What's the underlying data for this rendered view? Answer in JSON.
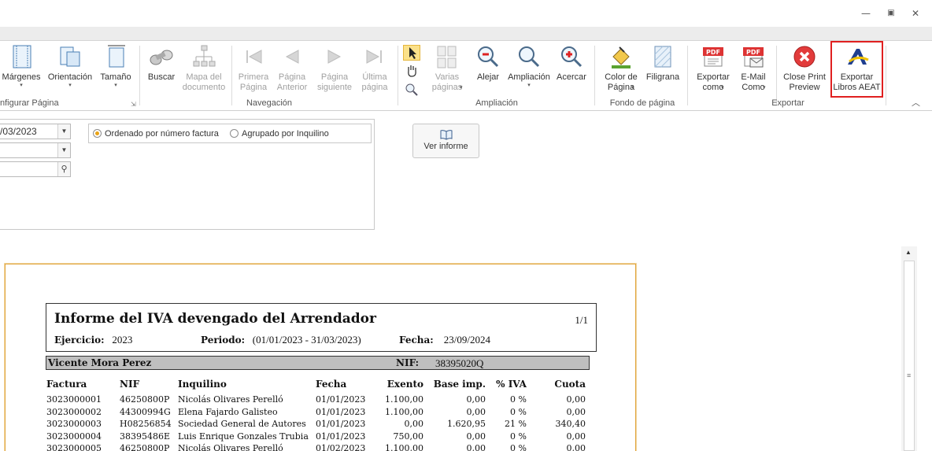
{
  "window": {
    "minimize": "▭",
    "restore": "⧉",
    "close": "✕"
  },
  "ribbon": {
    "groups": [
      {
        "label": "nfigurar Página",
        "buttons": [
          {
            "label": "Márgenes",
            "icon": "margins-icon",
            "arrow": "▾"
          },
          {
            "label": "Orientación",
            "icon": "orientation-icon",
            "arrow": "▾"
          },
          {
            "label": "Tamaño",
            "icon": "page-size-icon",
            "arrow": "▾"
          }
        ]
      },
      {
        "label": "Navegación",
        "buttons": [
          {
            "label": "Buscar",
            "icon": "binoculars-icon"
          },
          {
            "label": "Mapa del\ndocumento",
            "icon": "document-map-icon"
          },
          {
            "label": "Primera\nPágina",
            "icon": "first-page-icon"
          },
          {
            "label": "Página\nAnterior",
            "icon": "previous-page-icon"
          },
          {
            "label": "Página\nsiguiente",
            "icon": "next-page-icon"
          },
          {
            "label": "Última\npágina",
            "icon": "last-page-icon"
          }
        ]
      },
      {
        "label": "Ampliación",
        "buttons": [
          {
            "label": "Varias\npáginas",
            "icon": "multiple-pages-icon",
            "arrow": "▾"
          },
          {
            "label": "Alejar",
            "icon": "zoom-out-icon"
          },
          {
            "label": "Ampliación",
            "icon": "zoom-icon",
            "arrow": "▾"
          },
          {
            "label": "Acercar",
            "icon": "zoom-in-icon"
          }
        ]
      },
      {
        "label": "Fondo de página",
        "buttons": [
          {
            "label": "Color de\nPágina",
            "icon": "page-color-icon",
            "arrow": "▾"
          },
          {
            "label": "Filigrana",
            "icon": "watermark-icon"
          }
        ]
      },
      {
        "label": "Exportar",
        "buttons": [
          {
            "label": "Exportar\ncomo",
            "icon": "pdf-export-icon",
            "arrow": "▾"
          },
          {
            "label": "E-Mail\nComo",
            "icon": "pdf-email-icon",
            "arrow": "▾"
          },
          {
            "label": "Close Print\nPreview",
            "icon": "close-preview-icon"
          },
          {
            "label": "Exportar\nLibros AEAT",
            "icon": "aeat-logo-icon"
          }
        ]
      }
    ],
    "collapse_glyph": "︿"
  },
  "params": {
    "date_value": "/03/2023",
    "combo2_value": "",
    "search_value": "",
    "radio_option1": "Ordenado por número factura",
    "radio_option2": "Agrupado por Inquilino",
    "ver_informe": "Ver informe"
  },
  "report": {
    "title": "Informe del IVA devengado del Arrendador",
    "page": "1/1",
    "ejercicio_label": "Ejercicio:",
    "ejercicio_value": "2023",
    "periodo_label": "Periodo:",
    "periodo_value": "(01/01/2023 - 31/03/2023)",
    "fecha_label": "Fecha:",
    "fecha_value": "23/09/2024",
    "owner_name": "Vicente Mora Perez",
    "owner_nif_label": "NIF:",
    "owner_nif": "38395020Q",
    "columns": [
      "Factura",
      "NIF",
      "Inquilino",
      "Fecha",
      "Exento",
      "Base imp.",
      "% IVA",
      "Cuota"
    ],
    "rows": [
      [
        "3023000001",
        "46250800P",
        "Nicolás Olivares Perelló",
        "01/01/2023",
        "1.100,00",
        "0,00",
        "0 %",
        "0,00"
      ],
      [
        "3023000002",
        "44300994G",
        "Elena Fajardo Galisteo",
        "01/01/2023",
        "1.100,00",
        "0,00",
        "0 %",
        "0,00"
      ],
      [
        "3023000003",
        "H08256854",
        "Sociedad General de Autores",
        "01/01/2023",
        "0,00",
        "1.620,95",
        "21 %",
        "340,40"
      ],
      [
        "3023000004",
        "38395486E",
        "Luis Enrique Gonzales Trubia",
        "01/01/2023",
        "750,00",
        "0,00",
        "0 %",
        "0,00"
      ],
      [
        "3023000005",
        "46250800P",
        "Nicolás Olivares Perelló",
        "01/02/2023",
        "1.100,00",
        "0,00",
        "0 %",
        "0,00"
      ]
    ]
  }
}
